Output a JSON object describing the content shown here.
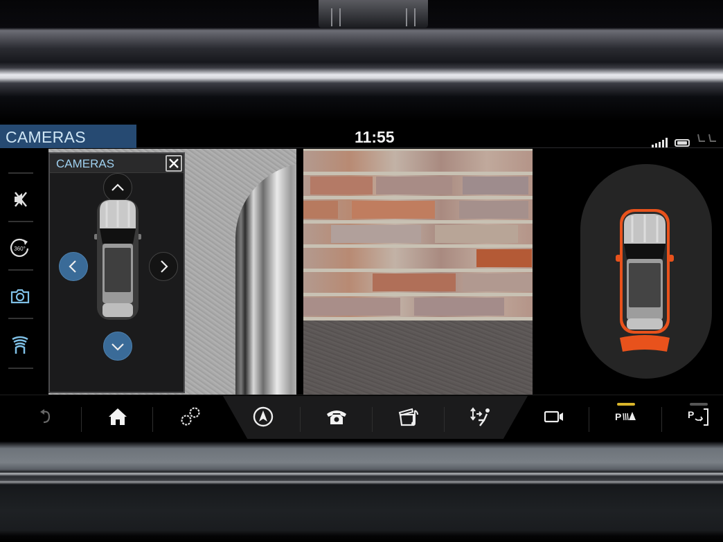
{
  "header": {
    "title": "CAMERAS",
    "time": "11:55",
    "status_icons": [
      "signal-icon",
      "battery-icon",
      "seat-icon"
    ]
  },
  "sidebar": {
    "items": [
      {
        "icon": "mute-sensor-icon",
        "label": "Mute parking sensors",
        "color": "#e0e0e0"
      },
      {
        "icon": "camera-360-icon",
        "label": "360 view",
        "color": "#e0e0e0"
      },
      {
        "icon": "camera-icon",
        "label": "Camera",
        "color": "#7fc0e6"
      },
      {
        "icon": "parking-sensor-icon",
        "label": "Parking sensors",
        "color": "#7fc0e6"
      }
    ]
  },
  "camera_panel": {
    "title": "CAMERAS",
    "close_icon": "close-icon",
    "views": [
      {
        "name": "front",
        "icon": "chevron-up-icon",
        "active": false
      },
      {
        "name": "left",
        "icon": "chevron-left-icon",
        "active": true
      },
      {
        "name": "right",
        "icon": "chevron-right-icon",
        "active": false
      },
      {
        "name": "rear",
        "icon": "chevron-down-icon",
        "active": true
      }
    ]
  },
  "camera_views": {
    "left_view": "Left side camera feed",
    "right_view": "Rear camera feed"
  },
  "parking_sensors": {
    "rear_alert": true,
    "alert_color": "#e8521c"
  },
  "bottom_nav": {
    "items": [
      {
        "icon": "back-icon",
        "label": "Back"
      },
      {
        "icon": "home-icon",
        "label": "Home"
      },
      {
        "icon": "settings-icon",
        "label": "Settings"
      },
      {
        "icon": "navigation-icon",
        "label": "Navigation"
      },
      {
        "icon": "phone-icon",
        "label": "Phone"
      },
      {
        "icon": "media-icon",
        "label": "Media"
      },
      {
        "icon": "climate-icon",
        "label": "Climate"
      },
      {
        "icon": "camera-icon",
        "label": "Camera"
      },
      {
        "icon": "park-distance-icon",
        "label": "Park distance control",
        "indicator": "#d9b52a"
      },
      {
        "icon": "park-assist-icon",
        "label": "Park assist",
        "indicator": "#555555"
      }
    ]
  },
  "colors": {
    "accent_blue": "#264a72",
    "active_button": "#3a6b98",
    "title_text": "#cfe6f5",
    "alert_orange": "#e8521c",
    "indicator_yellow": "#d9b52a"
  }
}
